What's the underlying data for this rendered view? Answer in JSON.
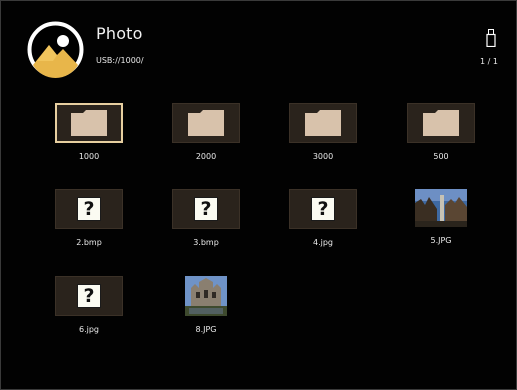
{
  "header": {
    "title": "Photo",
    "path": "USB://1000/",
    "page_indicator": "1 / 1"
  },
  "colors": {
    "background": "#000000",
    "folder": "#d8c2ab",
    "selection_border": "#e7cfa0",
    "tile_background": "#2a231c",
    "unknown_icon_bg": "#fbfbf2"
  },
  "items": [
    {
      "label": "1000",
      "kind": "folder",
      "selected": true
    },
    {
      "label": "2000",
      "kind": "folder",
      "selected": false
    },
    {
      "label": "3000",
      "kind": "folder",
      "selected": false
    },
    {
      "label": "500",
      "kind": "folder",
      "selected": false
    },
    {
      "label": "2.bmp",
      "kind": "unknown",
      "selected": false,
      "icon": "?"
    },
    {
      "label": "3.bmp",
      "kind": "unknown",
      "selected": false,
      "icon": "?"
    },
    {
      "label": "4.jpg",
      "kind": "unknown",
      "selected": false,
      "icon": "?"
    },
    {
      "label": "5.JPG",
      "kind": "photo",
      "selected": false
    },
    {
      "label": "6.jpg",
      "kind": "unknown",
      "selected": false,
      "icon": "?"
    },
    {
      "label": "8.JPG",
      "kind": "photo",
      "selected": false
    }
  ]
}
